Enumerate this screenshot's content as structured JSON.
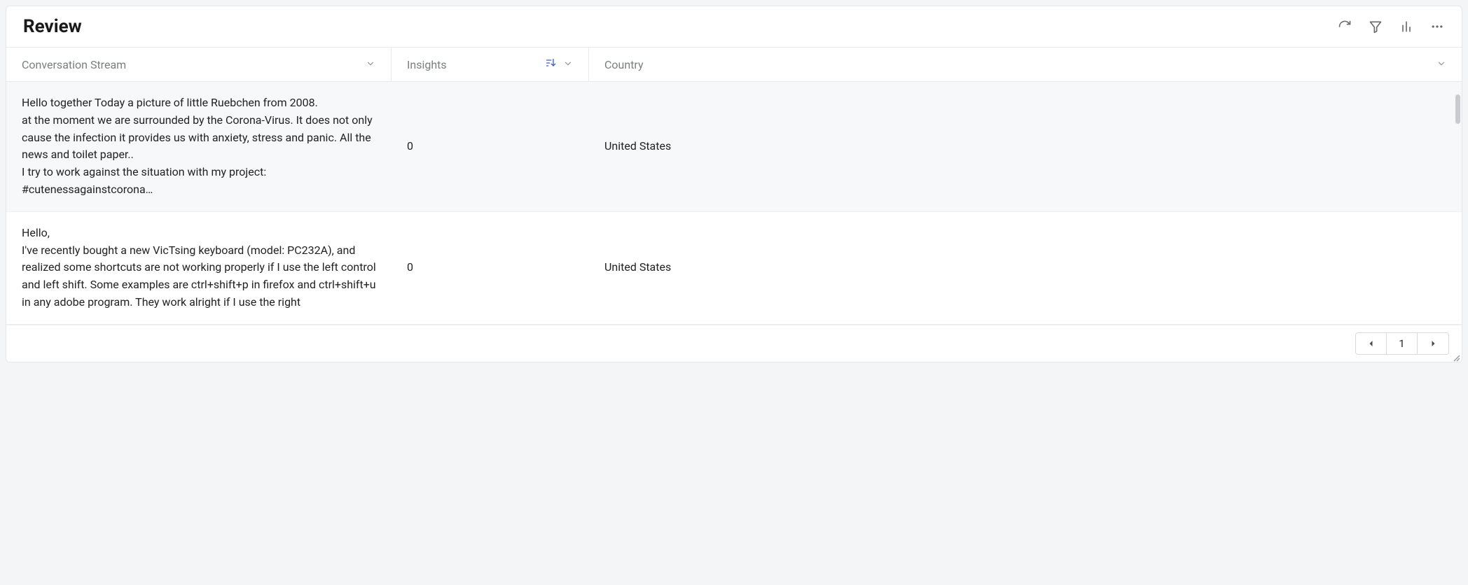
{
  "header": {
    "title": "Review"
  },
  "toolbar": {
    "refresh": "refresh",
    "filter": "filter",
    "chart": "chart",
    "more": "more"
  },
  "columns": {
    "conversation": "Conversation Stream",
    "insights": "Insights",
    "country": "Country"
  },
  "rows": [
    {
      "conversation": "Hello together Today a picture of little Ruebchen from 2008.\nat the moment we are surrounded by the Corona-Virus. It does not only cause the infection it provides us with anxiety, stress and panic. All the news and toilet paper..\nI try to work against the situation with my project: #cutenessagainstcorona…",
      "insights": "0",
      "country": "United States"
    },
    {
      "conversation": "Hello,\nI've recently bought a new VicTsing keyboard (model: PC232A), and realized some shortcuts are not working properly if I use the left control and left shift. Some examples are ctrl+shift+p in firefox and ctrl+shift+u in any adobe program. They work alright if I use the right",
      "insights": "0",
      "country": "United States"
    }
  ],
  "pager": {
    "page": "1"
  }
}
